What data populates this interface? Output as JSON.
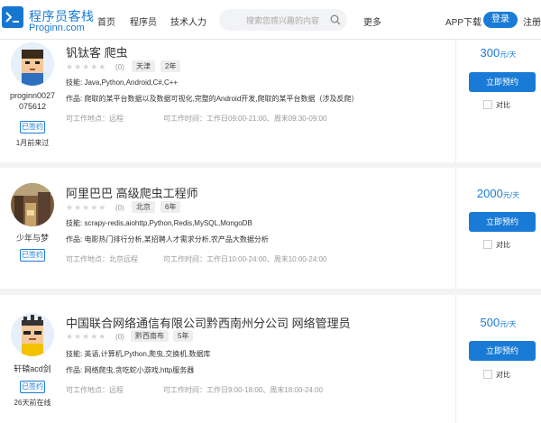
{
  "header": {
    "logo_cn": "程序员客栈",
    "logo_en": "Proginn.com",
    "nav": [
      "首页",
      "程序员",
      "技术人力"
    ],
    "search_placeholder": "搜索您感兴趣的内容",
    "more": "更多",
    "app_download": "APP下载",
    "login": "登录",
    "register": "注册"
  },
  "labels": {
    "skills": "技能:",
    "works": "作品:",
    "book": "立即预约",
    "compare": "对比",
    "signed": "已签约",
    "price_unit": "元/天",
    "rating": "(0)"
  },
  "cards": [
    {
      "username": "proginn0027 075612",
      "last_seen": "1月前来过",
      "title": "钒钛客  爬虫",
      "tags": [
        "天津",
        "2年"
      ],
      "skills": "Java,Python,Android,C#,C++",
      "works": "爬取的某平台数据以及数据可视化,完整的Android开发,爬取的某平台数据（涉及反爬）",
      "location": "可工作地点：远程",
      "hours": "可工作时间：工作日09:00-21:00、周末09:30-09:00",
      "price": "300",
      "rating_stars": 0
    },
    {
      "username": "少年与梦",
      "last_seen": "",
      "title": "阿里巴巴  高级爬虫工程师",
      "tags": [
        "北京",
        "6年"
      ],
      "skills": "scrapy-redis,aiohttp,Python,Redis,MySQL,MongoDB",
      "works": "电影热门排行分析,某招聘人才需求分析,农产品大数据分析",
      "location": "可工作地点：北京远程",
      "hours": "可工作时间：工作日10:00-24:00、周末10:00-24:00",
      "price": "2000",
      "rating_stars": 0
    },
    {
      "username": "轩辕acd剑",
      "last_seen": "26天前在线",
      "title": "中国联合网络通信有限公司黔西南州分公司  网络管理员",
      "tags": [
        "黔西南布",
        "5年"
      ],
      "skills": "英语,计算机,Python,爬虫,交换机,数据库",
      "works": "网络爬虫,贪吃蛇小游戏,http服务器",
      "location": "可工作地点：远程",
      "hours": "可工作时间：工作日9:00-18:00、周末18:00-24:00",
      "price": "500",
      "rating_stars": 0
    }
  ]
}
